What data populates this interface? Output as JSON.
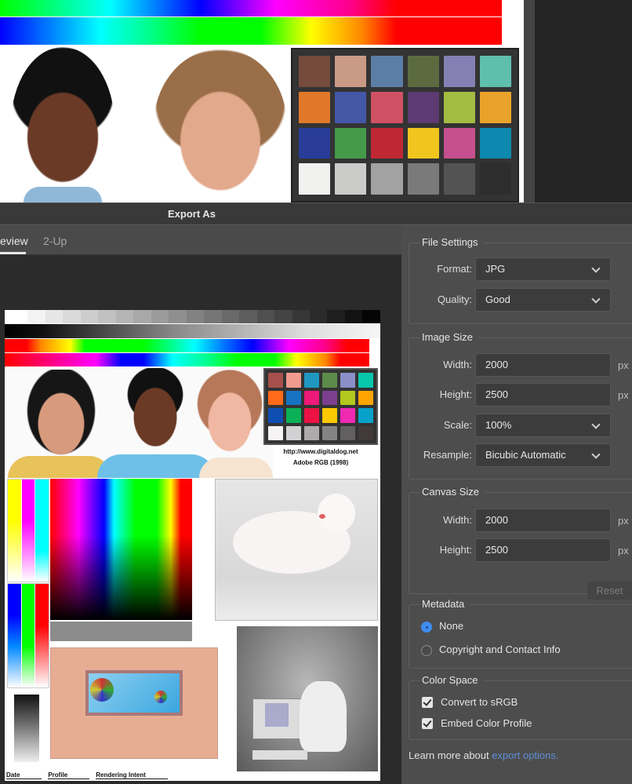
{
  "dialog": {
    "title": "Export As",
    "tabs": [
      {
        "label": "eview",
        "full_label": "Preview",
        "active": true
      },
      {
        "label": "2-Up",
        "active": false
      }
    ]
  },
  "file_settings": {
    "title": "File Settings",
    "format_label": "Format:",
    "format_value": "JPG",
    "quality_label": "Quality:",
    "quality_value": "Good"
  },
  "image_size": {
    "title": "Image Size",
    "width_label": "Width:",
    "width_value": "2000",
    "height_label": "Height:",
    "height_value": "2500",
    "scale_label": "Scale:",
    "scale_value": "100%",
    "resample_label": "Resample:",
    "resample_value": "Bicubic Automatic",
    "unit": "px"
  },
  "canvas_size": {
    "title": "Canvas Size",
    "width_label": "Width:",
    "width_value": "2000",
    "height_label": "Height:",
    "height_value": "2500",
    "unit": "px",
    "reset_label": "Reset"
  },
  "metadata": {
    "title": "Metadata",
    "options": [
      {
        "label": "None",
        "selected": true
      },
      {
        "label": "Copyright and Contact Info",
        "selected": false
      }
    ]
  },
  "color_space": {
    "title": "Color Space",
    "convert_label": "Convert to sRGB",
    "convert_checked": true,
    "embed_label": "Embed Color Profile",
    "embed_checked": true
  },
  "learn_more": {
    "prefix": "Learn more about ",
    "link": "export options."
  },
  "preview_doc": {
    "url": "http://www.digitaldog.net",
    "profile": "Adobe RGB (1998)",
    "footer": [
      "Date",
      "Profile",
      "Rendering Intent"
    ]
  },
  "colors": {
    "accent": "#3f8cf0",
    "link": "#5f8ed8",
    "panel": "#4d4d4d"
  },
  "checker_top": [
    "#754b3e",
    "#c99a86",
    "#5b7ea6",
    "#5c6b3f",
    "#8580b4",
    "#5fbfad",
    "#e0782a",
    "#4458a8",
    "#cf5164",
    "#5d3a72",
    "#a3bc42",
    "#eaa32a",
    "#283c98",
    "#459a4a",
    "#bf2734",
    "#f0c51e",
    "#c4508e",
    "#0d88ae",
    "#f1f1ef",
    "#cbcbca",
    "#a2a2a2",
    "#7a7a7a",
    "#535353",
    "#2d2d2d"
  ],
  "checker_preview": [
    "#a74f4b",
    "#f19b8f",
    "#1f98c1",
    "#5d8b4a",
    "#8a8fc9",
    "#07c7ab",
    "#ff6a1a",
    "#1773c3",
    "#ee1979",
    "#7c3f8e",
    "#b3c91d",
    "#ffa400",
    "#0f4fb4",
    "#0ab156",
    "#ec1244",
    "#fdc900",
    "#ee2ab3",
    "#07a2c9",
    "#f5f3f4",
    "#d1d0d2",
    "#aeaaab",
    "#858484",
    "#615f5f",
    "#423a39"
  ]
}
